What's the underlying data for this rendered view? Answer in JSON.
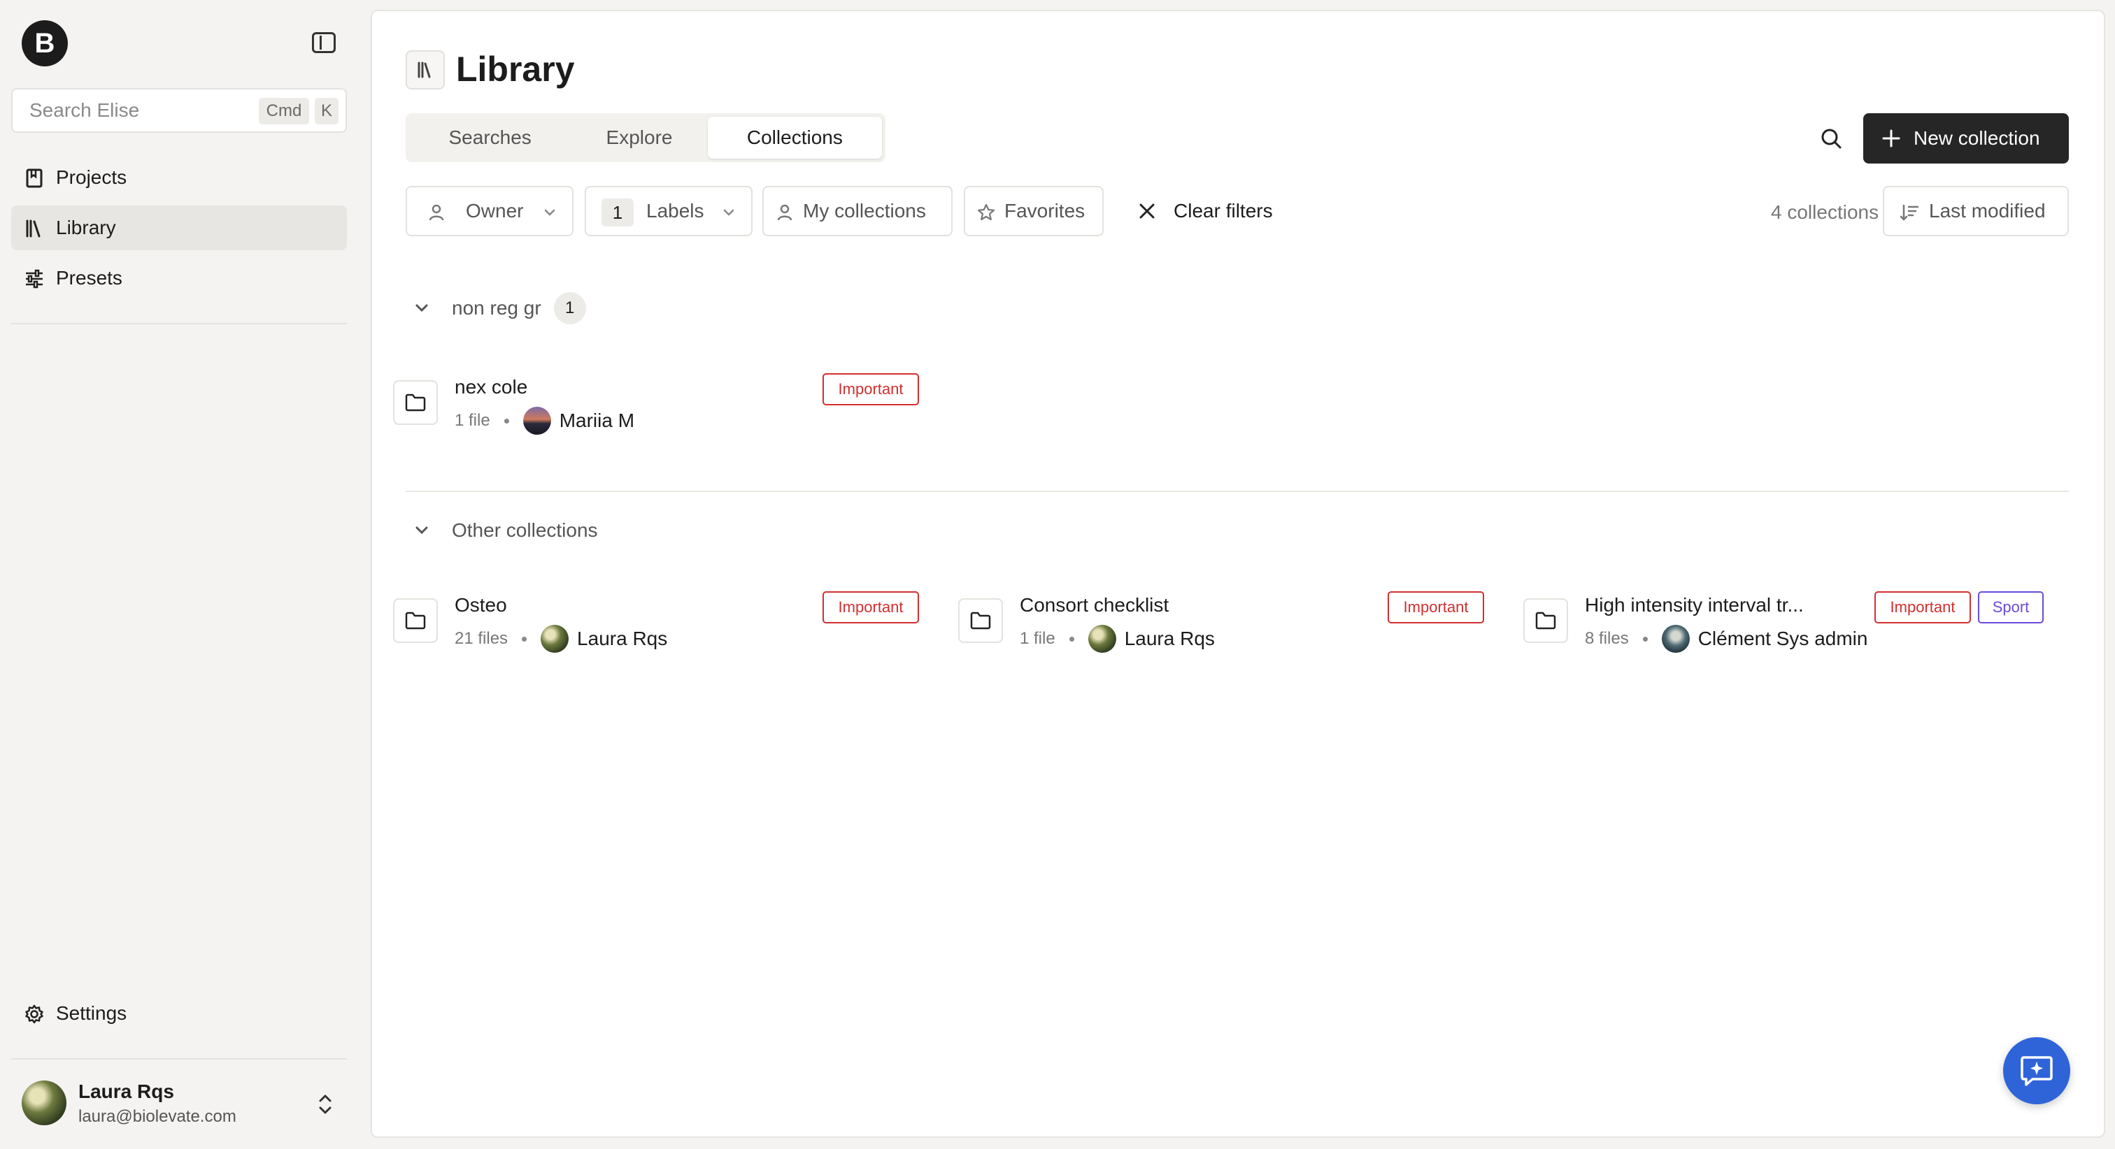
{
  "sidebar": {
    "logo_letter": "B",
    "search": {
      "placeholder": "Search Elise",
      "shortcut_cmd": "Cmd",
      "shortcut_key": "K"
    },
    "nav": [
      {
        "label": "Projects",
        "icon": "bookmark-book-icon"
      },
      {
        "label": "Library",
        "icon": "library-books-icon",
        "active": true
      },
      {
        "label": "Presets",
        "icon": "sliders-icon"
      }
    ],
    "settings_label": "Settings",
    "user": {
      "name": "Laura Rqs",
      "email": "laura@biolevate.com"
    }
  },
  "main": {
    "title": "Library",
    "tabs": [
      {
        "label": "Searches"
      },
      {
        "label": "Explore"
      },
      {
        "label": "Collections",
        "active": true
      }
    ],
    "new_collection_label": "New collection",
    "filters": {
      "owner": "Owner",
      "labels": "Labels",
      "labels_count": "1",
      "my_collections": "My collections",
      "favorites": "Favorites",
      "clear": "Clear filters"
    },
    "collections_count": "4 collections",
    "sort_label": "Last modified",
    "groups": [
      {
        "name": "non reg gr",
        "count": "1",
        "items": [
          {
            "title": "nex cole",
            "files": "1 file",
            "owner": "Mariia M",
            "tags": [
              "Important"
            ]
          }
        ]
      },
      {
        "name": "Other collections",
        "items": [
          {
            "title": "Osteo",
            "files": "21 files",
            "owner": "Laura Rqs",
            "tags": [
              "Important"
            ]
          },
          {
            "title": "Consort checklist",
            "files": "1 file",
            "owner": "Laura Rqs",
            "tags": [
              "Important"
            ]
          },
          {
            "title": "High intensity interval tr...",
            "files": "8 files",
            "owner": "Clément Sys admin",
            "tags": [
              "Important",
              "Sport"
            ]
          }
        ]
      }
    ]
  },
  "colors": {
    "important_tag": "#d32f2f",
    "sport_tag": "#6a4bd9",
    "primary_button": "#262626",
    "chat_fab": "#2f64d9"
  }
}
